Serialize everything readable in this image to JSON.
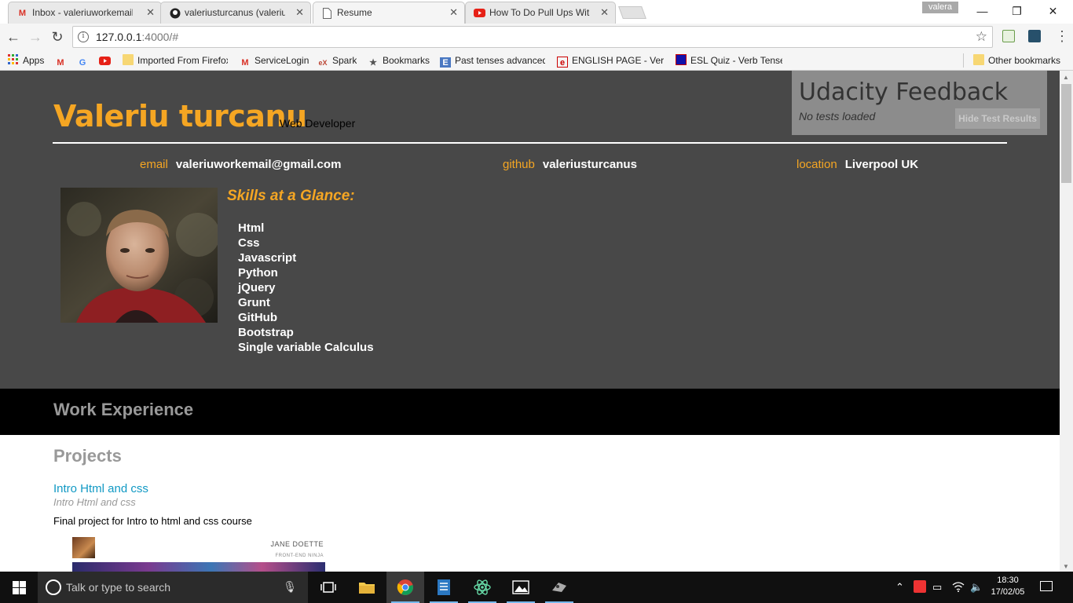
{
  "browser": {
    "tabs": [
      {
        "title": "Inbox - valeriuworkemail",
        "icon": "gmail-icon",
        "active": false
      },
      {
        "title": "valeriusturcanus (valeriu)",
        "icon": "github-icon",
        "active": false
      },
      {
        "title": "Resume",
        "icon": "document-icon",
        "active": true
      },
      {
        "title": "How To Do Pull Ups With",
        "icon": "youtube-icon",
        "active": false
      }
    ],
    "user_badge": "valera",
    "url_host": "127.0.0.1",
    "url_rest": ":4000/#",
    "bookmarks": [
      {
        "label": "Apps",
        "icon": "apps-grid-icon"
      },
      {
        "label": "",
        "icon": "gmail-icon"
      },
      {
        "label": "",
        "icon": "google-icon"
      },
      {
        "label": "",
        "icon": "youtube-icon"
      },
      {
        "label": "Imported From Firefox",
        "icon": "folder-icon"
      },
      {
        "label": "ServiceLogin",
        "icon": "gmail-icon"
      },
      {
        "label": "Spark",
        "icon": "edx-icon"
      },
      {
        "label": "Bookmarks",
        "icon": "star-icon"
      },
      {
        "label": "Past tenses advanced",
        "icon": "e-icon"
      },
      {
        "label": "ENGLISH PAGE - Verb",
        "icon": "englishpage-icon"
      },
      {
        "label": "ESL Quiz - Verb Tenses",
        "icon": "esl-icon"
      }
    ],
    "other_bookmarks": "Other bookmarks"
  },
  "resume": {
    "name": "Valeriu turcanu",
    "role": "Web Developer",
    "contacts": [
      {
        "key": "email",
        "value": "valeriuworkemail@gmail.com"
      },
      {
        "key": "github",
        "value": "valeriusturcanus"
      },
      {
        "key": "location",
        "value": "Liverpool UK"
      }
    ],
    "skills_title": "Skills at a Glance:",
    "skills": [
      "Html",
      "Css",
      "Javascript",
      "Python",
      "jQuery",
      "Grunt",
      "GitHub",
      "Bootstrap",
      "Single variable Calculus"
    ],
    "work_heading": "Work Experience",
    "projects_heading": "Projects",
    "project": {
      "title": "Intro Html and css",
      "date": "Intro Html and css",
      "description": "Final project for Intro to html and css course",
      "thumb_name": "JANE DOETTE",
      "thumb_sub": "FRONT-END NINJA"
    }
  },
  "feedback": {
    "title": "Udacity Feedback",
    "status": "No tests loaded",
    "button": "Hide Test Results"
  },
  "taskbar": {
    "search_placeholder": "Talk or type to search",
    "time": "18:30",
    "date": "17/02/05"
  }
}
